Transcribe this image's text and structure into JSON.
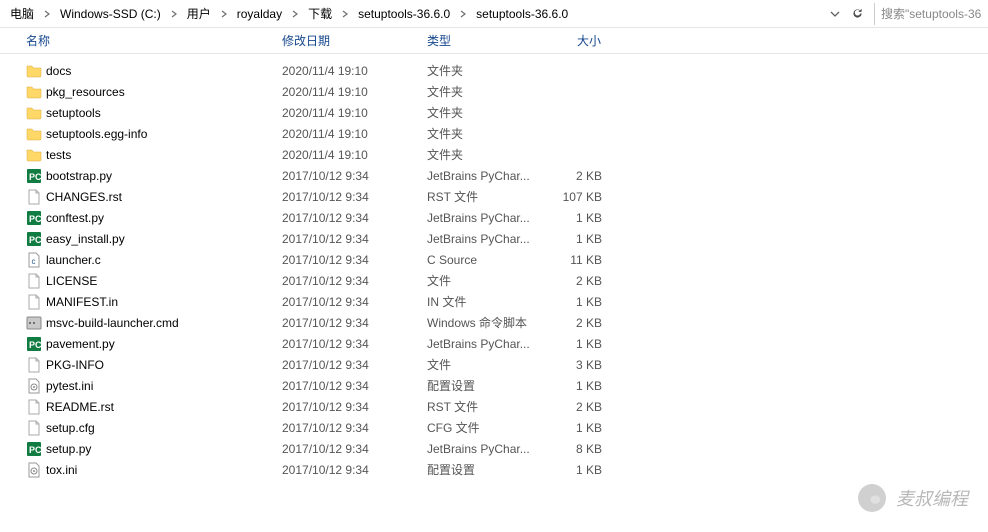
{
  "breadcrumb": [
    {
      "label": "电脑"
    },
    {
      "label": "Windows-SSD (C:)"
    },
    {
      "label": "用户"
    },
    {
      "label": "royalday"
    },
    {
      "label": "下载"
    },
    {
      "label": "setuptools-36.6.0"
    },
    {
      "label": "setuptools-36.6.0"
    }
  ],
  "search_placeholder": "搜索\"setuptools-36",
  "columns": {
    "name": "名称",
    "date": "修改日期",
    "type": "类型",
    "size": "大小"
  },
  "files": [
    {
      "icon": "folder",
      "name": "docs",
      "date": "2020/11/4 19:10",
      "type": "文件夹",
      "size": ""
    },
    {
      "icon": "folder",
      "name": "pkg_resources",
      "date": "2020/11/4 19:10",
      "type": "文件夹",
      "size": ""
    },
    {
      "icon": "folder",
      "name": "setuptools",
      "date": "2020/11/4 19:10",
      "type": "文件夹",
      "size": ""
    },
    {
      "icon": "folder",
      "name": "setuptools.egg-info",
      "date": "2020/11/4 19:10",
      "type": "文件夹",
      "size": ""
    },
    {
      "icon": "folder",
      "name": "tests",
      "date": "2020/11/4 19:10",
      "type": "文件夹",
      "size": ""
    },
    {
      "icon": "pycharm",
      "name": "bootstrap.py",
      "date": "2017/10/12 9:34",
      "type": "JetBrains PyChar...",
      "size": "2 KB"
    },
    {
      "icon": "file",
      "name": "CHANGES.rst",
      "date": "2017/10/12 9:34",
      "type": "RST 文件",
      "size": "107 KB"
    },
    {
      "icon": "pycharm",
      "name": "conftest.py",
      "date": "2017/10/12 9:34",
      "type": "JetBrains PyChar...",
      "size": "1 KB"
    },
    {
      "icon": "pycharm",
      "name": "easy_install.py",
      "date": "2017/10/12 9:34",
      "type": "JetBrains PyChar...",
      "size": "1 KB"
    },
    {
      "icon": "cfile",
      "name": "launcher.c",
      "date": "2017/10/12 9:34",
      "type": "C Source",
      "size": "11 KB"
    },
    {
      "icon": "file",
      "name": "LICENSE",
      "date": "2017/10/12 9:34",
      "type": "文件",
      "size": "2 KB"
    },
    {
      "icon": "file",
      "name": "MANIFEST.in",
      "date": "2017/10/12 9:34",
      "type": "IN 文件",
      "size": "1 KB"
    },
    {
      "icon": "cmd",
      "name": "msvc-build-launcher.cmd",
      "date": "2017/10/12 9:34",
      "type": "Windows 命令脚本",
      "size": "2 KB"
    },
    {
      "icon": "pycharm",
      "name": "pavement.py",
      "date": "2017/10/12 9:34",
      "type": "JetBrains PyChar...",
      "size": "1 KB"
    },
    {
      "icon": "file",
      "name": "PKG-INFO",
      "date": "2017/10/12 9:34",
      "type": "文件",
      "size": "3 KB"
    },
    {
      "icon": "ini",
      "name": "pytest.ini",
      "date": "2017/10/12 9:34",
      "type": "配置设置",
      "size": "1 KB"
    },
    {
      "icon": "file",
      "name": "README.rst",
      "date": "2017/10/12 9:34",
      "type": "RST 文件",
      "size": "2 KB"
    },
    {
      "icon": "file",
      "name": "setup.cfg",
      "date": "2017/10/12 9:34",
      "type": "CFG 文件",
      "size": "1 KB"
    },
    {
      "icon": "pycharm",
      "name": "setup.py",
      "date": "2017/10/12 9:34",
      "type": "JetBrains PyChar...",
      "size": "8 KB"
    },
    {
      "icon": "ini",
      "name": "tox.ini",
      "date": "2017/10/12 9:34",
      "type": "配置设置",
      "size": "1 KB"
    }
  ],
  "watermark": {
    "text": "麦叔编程"
  }
}
